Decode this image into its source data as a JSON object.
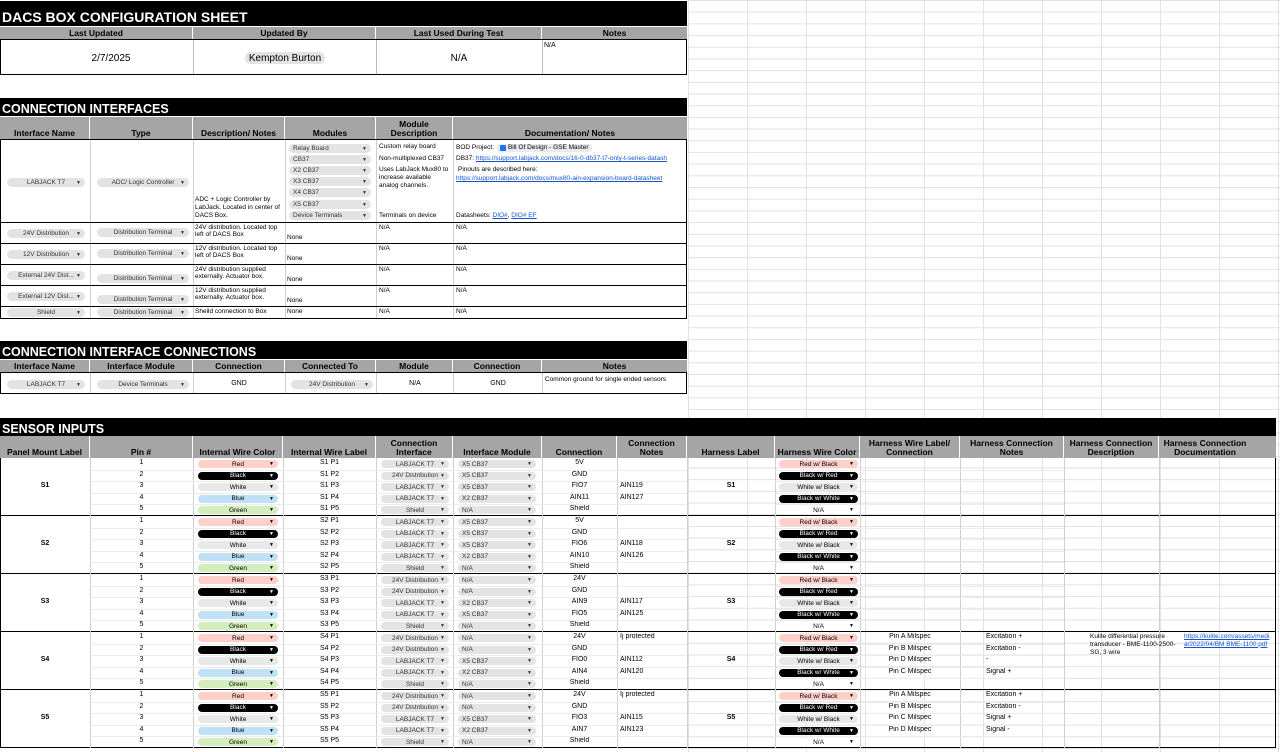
{
  "config": {
    "title": "DACS BOX CONFIGURATION SHEET",
    "headers": [
      "Last Updated",
      "Updated By",
      "Last Used During Test",
      "Notes"
    ],
    "last_updated": "2/7/2025",
    "updated_by": "Kempton Burton",
    "last_used": "N/A",
    "notes": "N/A"
  },
  "interfaces": {
    "title": "CONNECTION INTERFACES",
    "headers": [
      "Interface Name",
      "Type",
      "Description/ Notes",
      "Modules",
      "Module Description",
      "Documentation/ Notes"
    ],
    "labjack": {
      "name": "LABJACK T7",
      "type": "ADC/ Logic Controller",
      "desc": "ADC + Logic Controller by LabJack. Located in center of DACS Box.",
      "modules": [
        "Relay Board",
        "CB37",
        "X2 CB37",
        "X3 CB37",
        "X4 CB37",
        "X5 CB37",
        "Device Terminals"
      ],
      "mod_desc": [
        "Custom relay board",
        "Non-multiplexed CB37",
        "Uses LabJack Mux80 to increase available analog channels.",
        "Terminals on device"
      ],
      "doc_bod_prefix": "BOD Project:",
      "doc_bod_chip": "Bill Of Design - GSE Master",
      "doc_db37_prefix": "DB37:",
      "doc_db37_link": "https://support.labjack.com/docs/16-0-db37-t7-only-t-series-datash",
      "doc_pinout_prefix": "Pinouts are described here:",
      "doc_pinout_link": "https://support.labjack.com/docs/mux80-ain-expansion-board-datasheet",
      "doc_ds_prefix": "Datasheets:",
      "doc_ds_link1": "DIO#",
      "doc_ds_link2": "DIO# EF"
    },
    "rows": [
      {
        "name": "24V Distribution",
        "type": "Distribution Terminal",
        "desc": "24V distribution. Located top left of DACS Box",
        "module": "None",
        "mod_desc": "N/A",
        "doc": "N/A"
      },
      {
        "name": "12V Distribution",
        "type": "Distribution Terminal",
        "desc": "12V distribution. Located top left of DACS Box",
        "module": "None",
        "mod_desc": "N/A",
        "doc": "N/A"
      },
      {
        "name": "External 24V Dist...",
        "type": "Distribution Terminal",
        "desc": "24V distribution supplied externally. Actuator box.",
        "module": "None",
        "mod_desc": "N/A",
        "doc": "N/A"
      },
      {
        "name": "External 12V Dist...",
        "type": "Distribution Terminal",
        "desc": "12V distribution supplied externally. Actuator box.",
        "module": "None",
        "mod_desc": "N/A",
        "doc": "N/A"
      },
      {
        "name": "Shield",
        "type": "Distribution Terminal",
        "desc": "Sheild connection to Box",
        "module": "None",
        "mod_desc": "N/A",
        "doc": "N/A"
      }
    ]
  },
  "conn_conn": {
    "title": "CONNECTION INTERFACE CONNECTIONS",
    "headers": [
      "Interface Name",
      "Interface Module",
      "Connection",
      "Connected To",
      "Module",
      "Connection",
      "Notes"
    ],
    "row": {
      "iface": "LABJACK T7",
      "module": "Device Terminals",
      "connection": "GND",
      "to": "24V Distribution",
      "to_module": "N/A",
      "to_conn": "GND",
      "notes": "Common ground for single ended sensors"
    }
  },
  "sensors": {
    "title": "SENSOR INPUTS",
    "headers": [
      "Panel Mount Label",
      "Pin #",
      "Internal Wire Color",
      "Internal Wire Label",
      "Connection Interface",
      "Interface Module",
      "Connection",
      "Connection Notes",
      "Harness Label",
      "Harness Wire Color",
      "Harness Wire Label/ Connection",
      "Harness Connection Notes",
      "Harness Connection Description",
      "Harness Connection Documentation"
    ],
    "colors": {
      "Red": "#ffcfc9",
      "Black": "#000000",
      "White": "#e8e8e8",
      "Blue": "#bfe1f6",
      "Green": "#d4edbc",
      "Red w/ Black": "#ffcfc9",
      "Black w/ Red": "#000000",
      "White w/ Black": "#e8e8e8",
      "Black w/ White": "#000000",
      "N/A": "#ffffff"
    },
    "groups": [
      {
        "label": "S1",
        "harness": "S1",
        "desc": "",
        "doc": "",
        "rows": [
          {
            "pin": "1",
            "color": "Red",
            "wlabel": "S1 P1",
            "iface": "LABJACK T7",
            "module": "X5 CB37",
            "conn": "5V",
            "cnotes": "",
            "hcolor": "Red w/ Black",
            "hlabel": "",
            "hnotes": ""
          },
          {
            "pin": "2",
            "color": "Black",
            "wlabel": "S1 P2",
            "iface": "24V Distribution",
            "module": "X5 CB37",
            "conn": "GND",
            "cnotes": "",
            "hcolor": "Black w/ Red",
            "hlabel": "",
            "hnotes": ""
          },
          {
            "pin": "3",
            "color": "White",
            "wlabel": "S1 P3",
            "iface": "LABJACK T7",
            "module": "X5 CB37",
            "conn": "FIO7",
            "cnotes": "AIN119",
            "hcolor": "White w/ Black",
            "hlabel": "",
            "hnotes": ""
          },
          {
            "pin": "4",
            "color": "Blue",
            "wlabel": "S1 P4",
            "iface": "LABJACK T7",
            "module": "X2 CB37",
            "conn": "AIN11",
            "cnotes": "AIN127",
            "hcolor": "Black w/ White",
            "hlabel": "",
            "hnotes": ""
          },
          {
            "pin": "5",
            "color": "Green",
            "wlabel": "S1 P5",
            "iface": "Shield",
            "module": "N/A",
            "conn": "Shield",
            "cnotes": "",
            "hcolor": "N/A",
            "hlabel": "",
            "hnotes": ""
          }
        ]
      },
      {
        "label": "S2",
        "harness": "S2",
        "desc": "",
        "doc": "",
        "rows": [
          {
            "pin": "1",
            "color": "Red",
            "wlabel": "S2 P1",
            "iface": "LABJACK T7",
            "module": "X5 CB37",
            "conn": "5V",
            "cnotes": "",
            "hcolor": "Red w/ Black",
            "hlabel": "",
            "hnotes": ""
          },
          {
            "pin": "2",
            "color": "Black",
            "wlabel": "S2 P2",
            "iface": "LABJACK T7",
            "module": "X5 CB37",
            "conn": "GND",
            "cnotes": "",
            "hcolor": "Black w/ Red",
            "hlabel": "",
            "hnotes": ""
          },
          {
            "pin": "3",
            "color": "White",
            "wlabel": "S2 P3",
            "iface": "LABJACK T7",
            "module": "X5 CB37",
            "conn": "FIO6",
            "cnotes": "AIN118",
            "hcolor": "White w/ Black",
            "hlabel": "",
            "hnotes": ""
          },
          {
            "pin": "4",
            "color": "Blue",
            "wlabel": "S2 P4",
            "iface": "LABJACK T7",
            "module": "X2 CB37",
            "conn": "AIN10",
            "cnotes": "AIN126",
            "hcolor": "Black w/ White",
            "hlabel": "",
            "hnotes": ""
          },
          {
            "pin": "5",
            "color": "Green",
            "wlabel": "S2 P5",
            "iface": "Shield",
            "module": "N/A",
            "conn": "Shield",
            "cnotes": "",
            "hcolor": "N/A",
            "hlabel": "",
            "hnotes": ""
          }
        ]
      },
      {
        "label": "S3",
        "harness": "S3",
        "desc": "",
        "doc": "",
        "rows": [
          {
            "pin": "1",
            "color": "Red",
            "wlabel": "S3 P1",
            "iface": "24V Distribution",
            "module": "N/A",
            "conn": "24V",
            "cnotes": "",
            "hcolor": "Red w/ Black",
            "hlabel": "",
            "hnotes": ""
          },
          {
            "pin": "2",
            "color": "Black",
            "wlabel": "S3 P2",
            "iface": "24V Distribution",
            "module": "N/A",
            "conn": "GND",
            "cnotes": "",
            "hcolor": "Black w/ Red",
            "hlabel": "",
            "hnotes": ""
          },
          {
            "pin": "3",
            "color": "White",
            "wlabel": "S3 P3",
            "iface": "LABJACK T7",
            "module": "X2 CB37",
            "conn": "AIN9",
            "cnotes": "AIN117",
            "hcolor": "White w/ Black",
            "hlabel": "",
            "hnotes": ""
          },
          {
            "pin": "4",
            "color": "Blue",
            "wlabel": "S3 P4",
            "iface": "LABJACK T7",
            "module": "X5 CB37",
            "conn": "FIO5",
            "cnotes": "AIN125",
            "hcolor": "Black w/ White",
            "hlabel": "",
            "hnotes": ""
          },
          {
            "pin": "5",
            "color": "Green",
            "wlabel": "S3 P5",
            "iface": "Shield",
            "module": "N/A",
            "conn": "Shield",
            "cnotes": "",
            "hcolor": "N/A",
            "hlabel": "",
            "hnotes": ""
          }
        ]
      },
      {
        "label": "S4",
        "harness": "S4",
        "desc": "Kulite differential pressure transducer - BME-1100-2500-SG, 3 wire",
        "doc": "https://kulite.com/assets/media/2022/04/BM BME-1100.pdf",
        "rows": [
          {
            "pin": "1",
            "color": "Red",
            "wlabel": "S4 P1",
            "iface": "24V Distribution",
            "module": "N/A",
            "conn": "24V",
            "cnotes": "Ij protected",
            "hcolor": "Red w/ Black",
            "hlabel": "Pin A Milspec",
            "hnotes": "Excitation +"
          },
          {
            "pin": "2",
            "color": "Black",
            "wlabel": "S4 P2",
            "iface": "24V Distribution",
            "module": "N/A",
            "conn": "GND",
            "cnotes": "",
            "hcolor": "Black w/ Red",
            "hlabel": "Pin B Milspec",
            "hnotes": "Excitation -"
          },
          {
            "pin": "3",
            "color": "White",
            "wlabel": "S4 P3",
            "iface": "LABJACK T7",
            "module": "X5 CB37",
            "conn": "FIO0",
            "cnotes": "AIN112",
            "hcolor": "White w/ Black",
            "hlabel": "Pin D Milspec",
            "hnotes": "-"
          },
          {
            "pin": "4",
            "color": "Blue",
            "wlabel": "S4 P4",
            "iface": "LABJACK T7",
            "module": "X2 CB37",
            "conn": "AIN4",
            "cnotes": "AIN120",
            "hcolor": "Black w/ White",
            "hlabel": "Pin C Milspec",
            "hnotes": "Signal +"
          },
          {
            "pin": "5",
            "color": "Green",
            "wlabel": "S4 P5",
            "iface": "Shield",
            "module": "N/A",
            "conn": "Shield",
            "cnotes": "",
            "hcolor": "N/A",
            "hlabel": "",
            "hnotes": ""
          }
        ]
      },
      {
        "label": "S5",
        "harness": "S5",
        "desc": "",
        "doc": "",
        "rows": [
          {
            "pin": "1",
            "color": "Red",
            "wlabel": "S5 P1",
            "iface": "24V Distribution",
            "module": "N/A",
            "conn": "24V",
            "cnotes": "Ij protected",
            "hcolor": "Red w/ Black",
            "hlabel": "Pin A Milspec",
            "hnotes": "Excitation +"
          },
          {
            "pin": "2",
            "color": "Black",
            "wlabel": "S5 P2",
            "iface": "24V Distribution",
            "module": "N/A",
            "conn": "GND",
            "cnotes": "",
            "hcolor": "Black w/ Red",
            "hlabel": "Pin B Milspec",
            "hnotes": "Excitation -"
          },
          {
            "pin": "3",
            "color": "White",
            "wlabel": "S5 P3",
            "iface": "LABJACK T7",
            "module": "X5 CB37",
            "conn": "FIO3",
            "cnotes": "AIN115",
            "hcolor": "White w/ Black",
            "hlabel": "Pin C Milspec",
            "hnotes": "Signal +"
          },
          {
            "pin": "4",
            "color": "Blue",
            "wlabel": "S5 P4",
            "iface": "LABJACK T7",
            "module": "X2 CB37",
            "conn": "AIN7",
            "cnotes": "AIN123",
            "hcolor": "Black w/ White",
            "hlabel": "Pin D Milspec",
            "hnotes": "Signal -"
          },
          {
            "pin": "5",
            "color": "Green",
            "wlabel": "S5 P5",
            "iface": "Shield",
            "module": "N/A",
            "conn": "Shield",
            "cnotes": "",
            "hcolor": "N/A",
            "hlabel": "",
            "hnotes": ""
          }
        ]
      }
    ]
  }
}
